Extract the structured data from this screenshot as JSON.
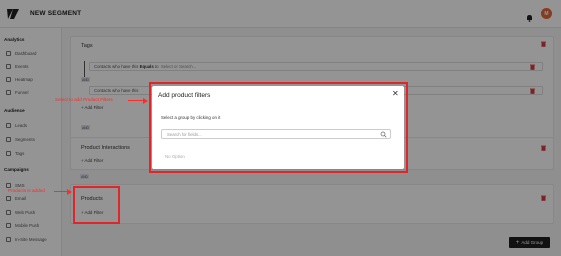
{
  "header": {
    "title": "NEW SEGMENT",
    "avatar_initial": "M"
  },
  "sidebar": {
    "sections": [
      {
        "title": "Analytics",
        "items": [
          "Dashboard",
          "Events",
          "Heatmap",
          "Funnel"
        ]
      },
      {
        "title": "Audience",
        "items": [
          "Leads",
          "Segments",
          "Tags"
        ]
      },
      {
        "title": "Campaigns",
        "items": [
          "SMS",
          "Email",
          "Web Push",
          "Mobile Push",
          "In-Site Message"
        ]
      }
    ]
  },
  "main": {
    "tags_card": {
      "title": "Tags"
    },
    "condition_row_1": {
      "text": "Contacts who have this",
      "operator": "Equals",
      "connector": "to",
      "value_placeholder": "Select or Search..."
    },
    "condition_row_2": {
      "text": "Contacts who have this"
    },
    "and_badge": "AND",
    "add_filter_label": "+ Add Filter",
    "product_interactions_card": {
      "title": "Product Interactions",
      "add_filter": "+ Add Filter"
    },
    "products_card": {
      "title": "Products",
      "add_filter": "+ Add Filter"
    },
    "add_group_button": "Add Group"
  },
  "modal": {
    "title": "Add product filters",
    "subtitle": "Select a group by clicking on it",
    "search_placeholder": "Search for fields...",
    "empty_text": "No Option"
  },
  "annotations": {
    "modal_note": "Select to add Product Filters",
    "products_note": "Products is added"
  },
  "colors": {
    "accent": "#e3673a",
    "annotation_red": "#e0252b",
    "danger": "#d9363e"
  }
}
